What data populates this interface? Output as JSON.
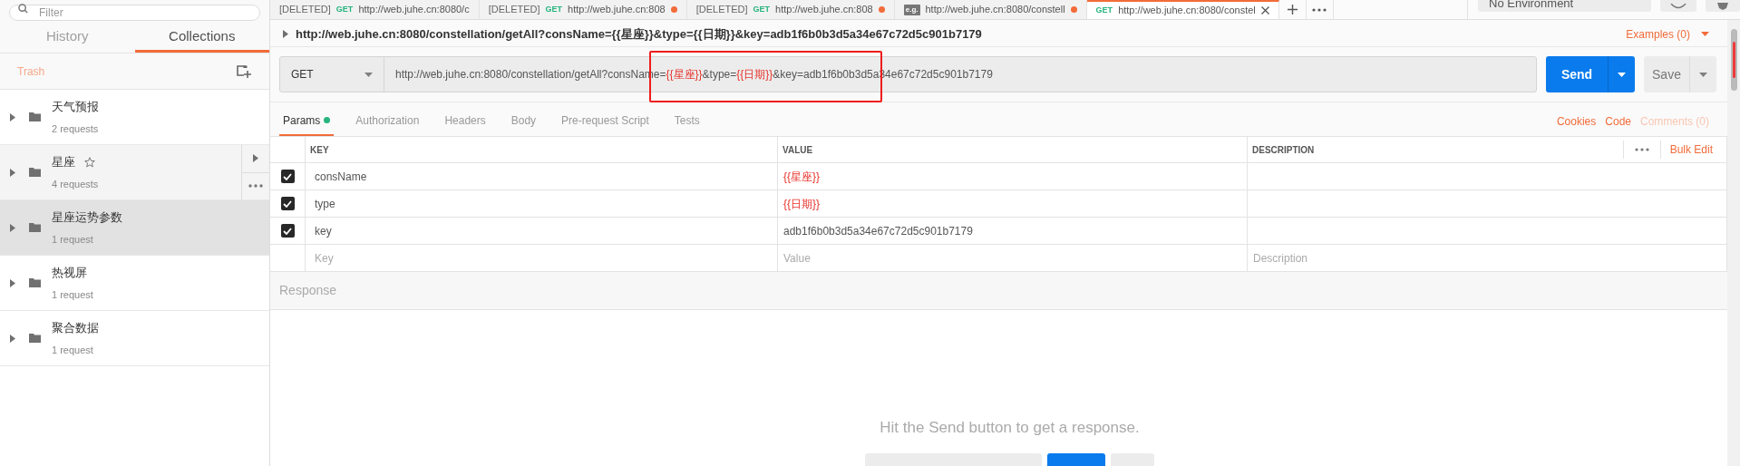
{
  "sidebar": {
    "filter": {
      "placeholder": "Filter"
    },
    "tabs": [
      {
        "label": "History",
        "selected": false
      },
      {
        "label": "Collections",
        "selected": true
      }
    ],
    "trash": "Trash",
    "collections": [
      {
        "name": "天气预报",
        "count": "2 requests",
        "starred": false,
        "hovered": false,
        "selected": false
      },
      {
        "name": "星座",
        "count": "4 requests",
        "starred": true,
        "hovered": true,
        "selected": false
      },
      {
        "name": "星座运势参数",
        "count": "1 request",
        "starred": false,
        "hovered": false,
        "selected": true
      },
      {
        "name": "热视屏",
        "count": "1 request",
        "starred": false,
        "hovered": false,
        "selected": false
      },
      {
        "name": "聚合数据",
        "count": "1 request",
        "starred": false,
        "hovered": false,
        "selected": false
      }
    ]
  },
  "request_tabs": [
    {
      "kind": "request",
      "status": "[DELETED]",
      "method": "GET",
      "url": "http://web.juhe.cn:8080/c",
      "unsaved": false,
      "selected": false
    },
    {
      "kind": "request",
      "status": "[DELETED]",
      "method": "GET",
      "url": "http://web.juhe.cn:808",
      "unsaved": true,
      "selected": false
    },
    {
      "kind": "request",
      "status": "[DELETED]",
      "method": "GET",
      "url": "http://web.juhe.cn:808",
      "unsaved": true,
      "selected": false
    },
    {
      "kind": "example",
      "badge": "e.g.",
      "url": "http://web.juhe.cn:8080/constell",
      "unsaved": true,
      "selected": false
    },
    {
      "kind": "request",
      "method": "GET",
      "url": "http://web.juhe.cn:8080/constel",
      "unsaved": false,
      "selected": true
    }
  ],
  "environment": {
    "value": "No Environment"
  },
  "request": {
    "title": "http://web.juhe.cn:8080/constellation/getAll?consName={{星座}}&type={{日期}}&key=adb1f6b0b3d5a34e67c72d5c901b7179",
    "examples": "Examples (0)",
    "method": "GET",
    "url_segments": [
      {
        "kind": "text",
        "text": "http://web.juhe.cn:8080/constellation/getAll?consName="
      },
      {
        "kind": "variable",
        "text": "{{星座}}"
      },
      {
        "kind": "text",
        "text": "&type="
      },
      {
        "kind": "variable",
        "text": "{{日期}}"
      },
      {
        "kind": "text",
        "text": "&key=adb1f6b0b3d5a34e67c72d5c901b7179"
      }
    ],
    "send": "Send",
    "save": "Save"
  },
  "request_sections": [
    {
      "label": "Params",
      "selected": true,
      "dot": true
    },
    {
      "label": "Authorization",
      "selected": false,
      "dot": false
    },
    {
      "label": "Headers",
      "selected": false,
      "dot": false
    },
    {
      "label": "Body",
      "selected": false,
      "dot": false
    },
    {
      "label": "Pre-request Script",
      "selected": false,
      "dot": false
    },
    {
      "label": "Tests",
      "selected": false,
      "dot": false
    }
  ],
  "section_links": [
    {
      "label": "Cookies",
      "disabled": false
    },
    {
      "label": "Code",
      "disabled": false
    },
    {
      "label": "Comments (0)",
      "disabled": true
    }
  ],
  "params": {
    "columns": [
      "KEY",
      "VALUE",
      "DESCRIPTION"
    ],
    "bulk_edit": "Bulk Edit",
    "rows": [
      {
        "checked": true,
        "key": "consName",
        "value": "{{星座}}",
        "kind": "variable"
      },
      {
        "checked": true,
        "key": "type",
        "value": "{{日期}}",
        "kind": "variable"
      },
      {
        "checked": true,
        "key": "key",
        "value": "adb1f6b0b3d5a34e67c72d5c901b7179",
        "kind": "text"
      }
    ],
    "empty_row": {
      "key": {
        "placeholder": "Key"
      },
      "value": {
        "placeholder": "Value"
      },
      "description": {
        "placeholder": "Description"
      }
    }
  },
  "response": {
    "title": "Response",
    "hint": "Hit the Send button to get a response."
  }
}
